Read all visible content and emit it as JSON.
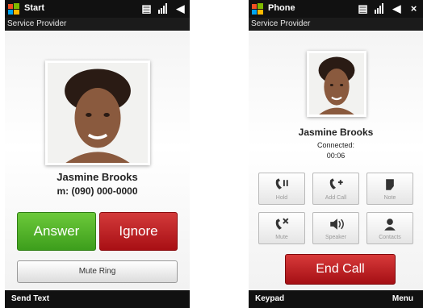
{
  "incoming": {
    "app_title": "Start",
    "provider": "Service Provider",
    "contact_name": "Jasmine Brooks",
    "contact_number": "m: (090) 000-0000",
    "answer_label": "Answer",
    "ignore_label": "Ignore",
    "mute_label": "Mute Ring",
    "softkey_left": "Send Text"
  },
  "in_call": {
    "app_title": "Phone",
    "provider": "Service Provider",
    "contact_name": "Jasmine Brooks",
    "status": "Connected:",
    "timer": "00:06",
    "controls": [
      {
        "label": "Hold",
        "icon": "hold-icon"
      },
      {
        "label": "Add Call",
        "icon": "add-call-icon"
      },
      {
        "label": "Note",
        "icon": "note-icon"
      },
      {
        "label": "Mute",
        "icon": "mute-icon"
      },
      {
        "label": "Speaker",
        "icon": "speaker-icon"
      },
      {
        "label": "Contacts",
        "icon": "contacts-icon"
      }
    ],
    "end_call_label": "End Call",
    "softkey_left": "Keypad",
    "softkey_right": "Menu"
  },
  "colors": {
    "answer": "#3d9e1c",
    "ignore": "#a80f14",
    "end_call": "#a50f14",
    "title_bar": "#111111"
  }
}
